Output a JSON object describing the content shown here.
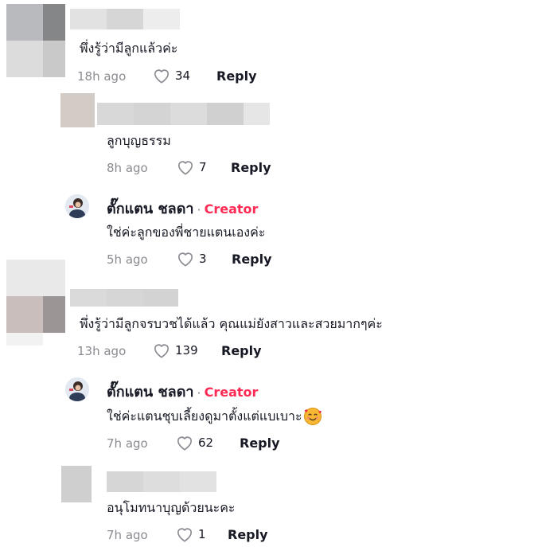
{
  "comments": [
    {
      "text": "พึ่งรู้ว่ามีลูกแล้วค่ะ",
      "time": "18h ago",
      "likes": "34",
      "reply": "Reply"
    },
    {
      "text": "ลูกบุญธรรม",
      "time": "8h ago",
      "likes": "7",
      "reply": "Reply"
    },
    {
      "author": "ตั๊กแตน ชลดา",
      "badge": "Creator",
      "dot": "·",
      "text": "ใช่ค่ะลูกของพี่ชายแตนเองค่ะ",
      "time": "5h ago",
      "likes": "3",
      "reply": "Reply"
    },
    {
      "text": "พึ่งรู้ว่ามีลูกจรบวชได้แล้ว คุณแม่ยังสาวและสวยมากๆค่ะ",
      "time": "13h ago",
      "likes": "139",
      "reply": "Reply"
    },
    {
      "author": "ตั๊กแตน ชลดา",
      "badge": "Creator",
      "dot": "·",
      "text": "ใช่ค่ะแตนชุบเลี้ยงดูมาตั้งแต่แบเบาะ",
      "time": "7h ago",
      "likes": "62",
      "reply": "Reply"
    },
    {
      "text": "อนุโมทนาบุญด้วยนะคะ",
      "time": "7h ago",
      "likes": "1",
      "reply": "Reply"
    }
  ],
  "colors": {
    "accent": "#fe2c55",
    "muted": "#8a8b91",
    "text": "#161823"
  },
  "icons": {
    "like": "heart-outline-icon",
    "emoji": "smiling-face-with-hearts-icon"
  }
}
